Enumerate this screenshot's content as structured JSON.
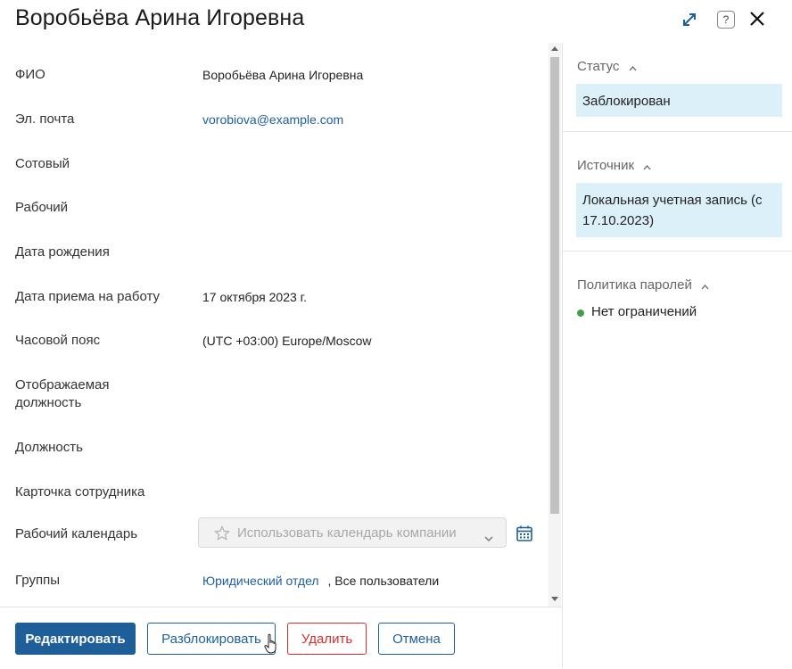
{
  "header": {
    "title": "Воробьёва Арина Игоревна",
    "help_label": "?"
  },
  "fields": [
    {
      "label": "ФИО",
      "value": "Воробьёва Арина Игоревна",
      "type": "text"
    },
    {
      "label": "Эл. почта",
      "value": "vorobiova@example.com",
      "type": "link"
    },
    {
      "label": "Сотовый",
      "value": "",
      "type": "text"
    },
    {
      "label": "Рабочий",
      "value": "",
      "type": "text"
    },
    {
      "label": "Дата рождения",
      "value": "",
      "type": "text"
    },
    {
      "label": "Дата приема на работу",
      "value": "17 октября 2023 г.",
      "type": "text"
    },
    {
      "label": "Часовой пояс",
      "value": "(UTC +03:00) Europe/Moscow",
      "type": "text"
    },
    {
      "label": "Отображаемая должность",
      "value": "",
      "type": "text"
    },
    {
      "label": "Должность",
      "value": "",
      "type": "text"
    },
    {
      "label": "Карточка сотрудника",
      "value": "",
      "type": "text"
    }
  ],
  "calendar": {
    "label": "Рабочий календарь",
    "placeholder": "Использовать календарь компании"
  },
  "groups": {
    "label": "Группы",
    "items": [
      "Юридический отдел",
      ", Все пользователи"
    ]
  },
  "buttons": {
    "edit": "Редактировать",
    "unblock": "Разблокировать",
    "delete": "Удалить",
    "cancel": "Отмена"
  },
  "sidebar": {
    "status_title": "Статус",
    "status_value": "Заблокирован",
    "source_title": "Источник",
    "source_value": "Локальная учетная запись (с 17.10.2023)",
    "policy_title": "Политика паролей",
    "policy_value": "Нет ограничений"
  },
  "colors": {
    "accent": "#1f5f99",
    "danger": "#d32f2f",
    "info_bg": "#dcf0f9",
    "ok": "#43a047"
  }
}
